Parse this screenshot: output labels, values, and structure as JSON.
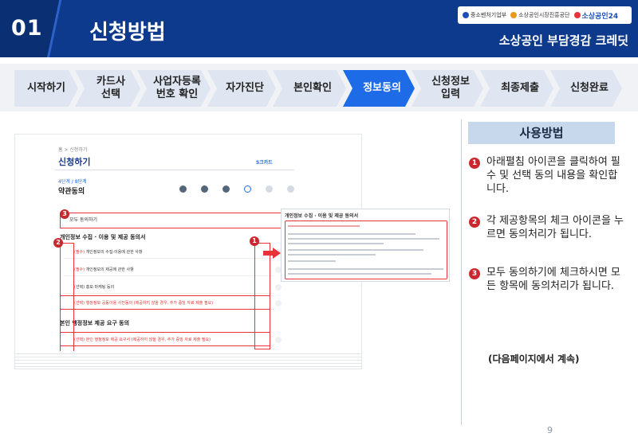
{
  "header": {
    "number": "01",
    "title": "신청방법",
    "subtitle": "소상공인 부담경감 크레딧",
    "logos": [
      "중소벤처기업부",
      "소상공인시장진흥공단",
      "소상공인24"
    ]
  },
  "steps": [
    "시작하기",
    "카드사\n선택",
    "사업자등록\n번호 확인",
    "자가진단",
    "본인확인",
    "정보동의",
    "신청정보\n입력",
    "최종제출",
    "신청완료"
  ],
  "active_step": "정보동의",
  "screenshot": {
    "breadcrumb": "홈 > 신청하기",
    "heading": "신청하기",
    "brand": "5크카드",
    "sub_small": "4단계 / 8단계",
    "sub_heading": "약관동의",
    "agree_all": "모두 동의하기",
    "section1": "개인정보 수집 · 이용 및 제공 동의서",
    "rows": [
      {
        "tag": "(필수)",
        "text": "개인정보의 수집·이용에 관한 사항"
      },
      {
        "tag": "(필수)",
        "text": "개인정보의 제공에 관한 사항"
      },
      {
        "tag": "(선택)",
        "text": "홍보·마케팅 등의"
      },
      {
        "tag": "(선택)",
        "text": "행정정보 공동이용 사전동의 (제공하지 않을 경우, 추가 증빙 자료 제출 필요)"
      }
    ],
    "section2": "본인 행정정보 제공 요구 동의",
    "row_last": {
      "tag": "(선택)",
      "text": "본인 행정정보 제공 요구서 (제공하지 않을 경우, 추가 증빙 자료 제출 필요)"
    },
    "popup_title": "개인정보 수집 · 이용 및 제공 동의서"
  },
  "usage": {
    "title": "사용방법",
    "tips": [
      {
        "num": "1",
        "text": "아래펼침 아이콘을 클릭하여 필수 및 선택 동의 내용을 확인합니다."
      },
      {
        "num": "2",
        "text": "각 제공항목의 체크 아이콘을 누르면 동의처리가 됩니다."
      },
      {
        "num": "3",
        "text": "모두 동의하기에 체크하시면 모든 항목에 동의처리가 됩니다."
      }
    ],
    "continue": "(다음페이지에서 계속)"
  },
  "page_number": "9",
  "colors": {
    "brand_blue": "#0d3a8c",
    "active_step": "#1e6be8",
    "highlight_red": "#e8333a"
  }
}
